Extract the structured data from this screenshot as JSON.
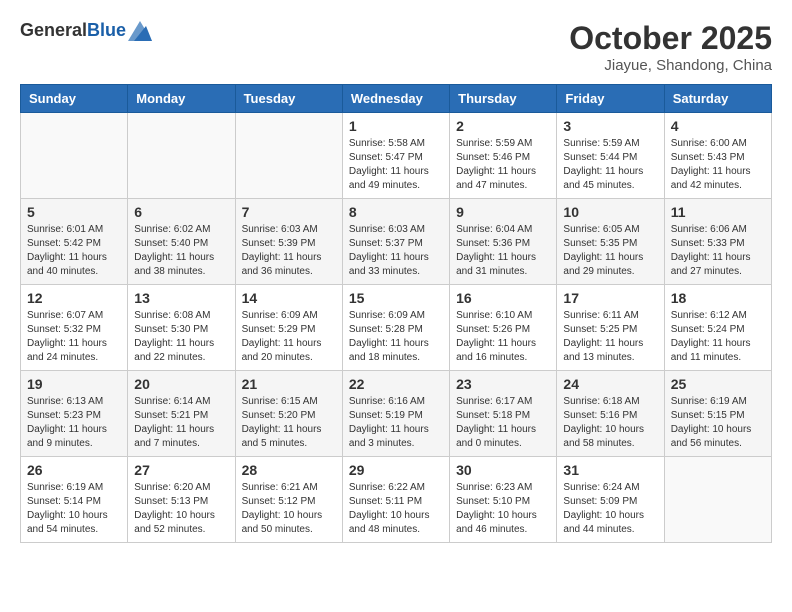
{
  "header": {
    "logo_general": "General",
    "logo_blue": "Blue",
    "month": "October 2025",
    "location": "Jiayue, Shandong, China"
  },
  "weekdays": [
    "Sunday",
    "Monday",
    "Tuesday",
    "Wednesday",
    "Thursday",
    "Friday",
    "Saturday"
  ],
  "weeks": [
    [
      {
        "day": "",
        "info": ""
      },
      {
        "day": "",
        "info": ""
      },
      {
        "day": "",
        "info": ""
      },
      {
        "day": "1",
        "info": "Sunrise: 5:58 AM\nSunset: 5:47 PM\nDaylight: 11 hours and 49 minutes."
      },
      {
        "day": "2",
        "info": "Sunrise: 5:59 AM\nSunset: 5:46 PM\nDaylight: 11 hours and 47 minutes."
      },
      {
        "day": "3",
        "info": "Sunrise: 5:59 AM\nSunset: 5:44 PM\nDaylight: 11 hours and 45 minutes."
      },
      {
        "day": "4",
        "info": "Sunrise: 6:00 AM\nSunset: 5:43 PM\nDaylight: 11 hours and 42 minutes."
      }
    ],
    [
      {
        "day": "5",
        "info": "Sunrise: 6:01 AM\nSunset: 5:42 PM\nDaylight: 11 hours and 40 minutes."
      },
      {
        "day": "6",
        "info": "Sunrise: 6:02 AM\nSunset: 5:40 PM\nDaylight: 11 hours and 38 minutes."
      },
      {
        "day": "7",
        "info": "Sunrise: 6:03 AM\nSunset: 5:39 PM\nDaylight: 11 hours and 36 minutes."
      },
      {
        "day": "8",
        "info": "Sunrise: 6:03 AM\nSunset: 5:37 PM\nDaylight: 11 hours and 33 minutes."
      },
      {
        "day": "9",
        "info": "Sunrise: 6:04 AM\nSunset: 5:36 PM\nDaylight: 11 hours and 31 minutes."
      },
      {
        "day": "10",
        "info": "Sunrise: 6:05 AM\nSunset: 5:35 PM\nDaylight: 11 hours and 29 minutes."
      },
      {
        "day": "11",
        "info": "Sunrise: 6:06 AM\nSunset: 5:33 PM\nDaylight: 11 hours and 27 minutes."
      }
    ],
    [
      {
        "day": "12",
        "info": "Sunrise: 6:07 AM\nSunset: 5:32 PM\nDaylight: 11 hours and 24 minutes."
      },
      {
        "day": "13",
        "info": "Sunrise: 6:08 AM\nSunset: 5:30 PM\nDaylight: 11 hours and 22 minutes."
      },
      {
        "day": "14",
        "info": "Sunrise: 6:09 AM\nSunset: 5:29 PM\nDaylight: 11 hours and 20 minutes."
      },
      {
        "day": "15",
        "info": "Sunrise: 6:09 AM\nSunset: 5:28 PM\nDaylight: 11 hours and 18 minutes."
      },
      {
        "day": "16",
        "info": "Sunrise: 6:10 AM\nSunset: 5:26 PM\nDaylight: 11 hours and 16 minutes."
      },
      {
        "day": "17",
        "info": "Sunrise: 6:11 AM\nSunset: 5:25 PM\nDaylight: 11 hours and 13 minutes."
      },
      {
        "day": "18",
        "info": "Sunrise: 6:12 AM\nSunset: 5:24 PM\nDaylight: 11 hours and 11 minutes."
      }
    ],
    [
      {
        "day": "19",
        "info": "Sunrise: 6:13 AM\nSunset: 5:23 PM\nDaylight: 11 hours and 9 minutes."
      },
      {
        "day": "20",
        "info": "Sunrise: 6:14 AM\nSunset: 5:21 PM\nDaylight: 11 hours and 7 minutes."
      },
      {
        "day": "21",
        "info": "Sunrise: 6:15 AM\nSunset: 5:20 PM\nDaylight: 11 hours and 5 minutes."
      },
      {
        "day": "22",
        "info": "Sunrise: 6:16 AM\nSunset: 5:19 PM\nDaylight: 11 hours and 3 minutes."
      },
      {
        "day": "23",
        "info": "Sunrise: 6:17 AM\nSunset: 5:18 PM\nDaylight: 11 hours and 0 minutes."
      },
      {
        "day": "24",
        "info": "Sunrise: 6:18 AM\nSunset: 5:16 PM\nDaylight: 10 hours and 58 minutes."
      },
      {
        "day": "25",
        "info": "Sunrise: 6:19 AM\nSunset: 5:15 PM\nDaylight: 10 hours and 56 minutes."
      }
    ],
    [
      {
        "day": "26",
        "info": "Sunrise: 6:19 AM\nSunset: 5:14 PM\nDaylight: 10 hours and 54 minutes."
      },
      {
        "day": "27",
        "info": "Sunrise: 6:20 AM\nSunset: 5:13 PM\nDaylight: 10 hours and 52 minutes."
      },
      {
        "day": "28",
        "info": "Sunrise: 6:21 AM\nSunset: 5:12 PM\nDaylight: 10 hours and 50 minutes."
      },
      {
        "day": "29",
        "info": "Sunrise: 6:22 AM\nSunset: 5:11 PM\nDaylight: 10 hours and 48 minutes."
      },
      {
        "day": "30",
        "info": "Sunrise: 6:23 AM\nSunset: 5:10 PM\nDaylight: 10 hours and 46 minutes."
      },
      {
        "day": "31",
        "info": "Sunrise: 6:24 AM\nSunset: 5:09 PM\nDaylight: 10 hours and 44 minutes."
      },
      {
        "day": "",
        "info": ""
      }
    ]
  ]
}
